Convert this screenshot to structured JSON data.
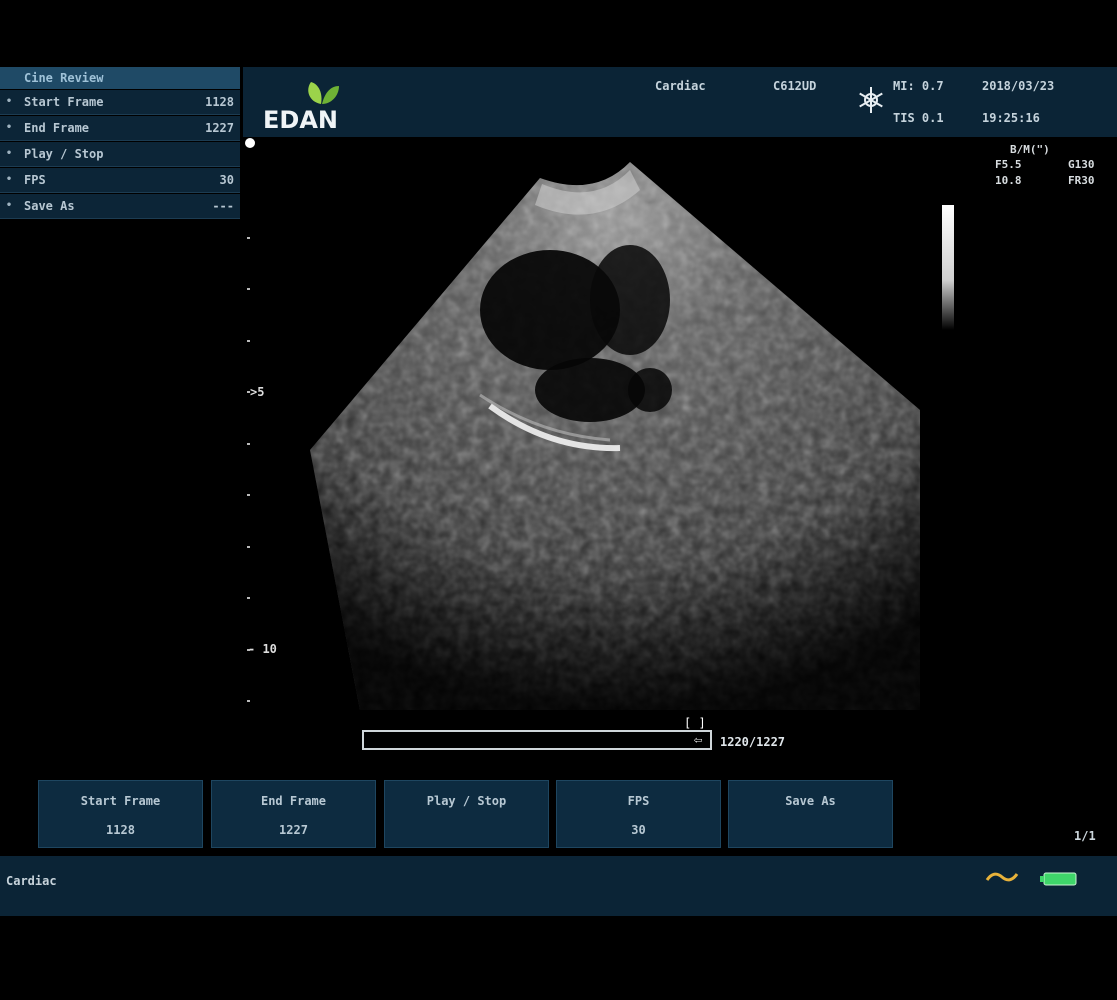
{
  "cine_menu": {
    "title": "Cine Review",
    "items": [
      {
        "label": "Start Frame",
        "value": "1128"
      },
      {
        "label": "End Frame",
        "value": "1227"
      },
      {
        "label": "Play / Stop",
        "value": ""
      },
      {
        "label": "FPS",
        "value": "30"
      },
      {
        "label": "Save As",
        "value": "---"
      }
    ]
  },
  "header": {
    "logo_text": "EDAN",
    "exam": "Cardiac",
    "probe": "C612UD",
    "mi": "MI: 0.7",
    "tis": "TIS 0.1",
    "date": "2018/03/23",
    "time": "19:25:16"
  },
  "params": {
    "line1": "B/M(\")",
    "line2_left": "F5.5",
    "line2_right": "G130",
    "line3_left": "10.8",
    "line3_right": "FR30"
  },
  "depth": {
    "label_5": "5",
    "label_10": "10"
  },
  "cine": {
    "counter": "1220/1227",
    "progress": 0.99
  },
  "softkeys": [
    {
      "label": "Start Frame",
      "value": "1128"
    },
    {
      "label": "End Frame",
      "value": "1227"
    },
    {
      "label": "Play / Stop",
      "value": ""
    },
    {
      "label": "FPS",
      "value": "30"
    },
    {
      "label": "Save As",
      "value": ""
    }
  ],
  "page_indicator": "1/1",
  "status": {
    "text": "Cardiac"
  },
  "colors": {
    "panel": "#0b2436",
    "logo_green": "#8fc63f",
    "battery_green": "#3fd66a",
    "wave_yellow": "#e8b23a"
  }
}
